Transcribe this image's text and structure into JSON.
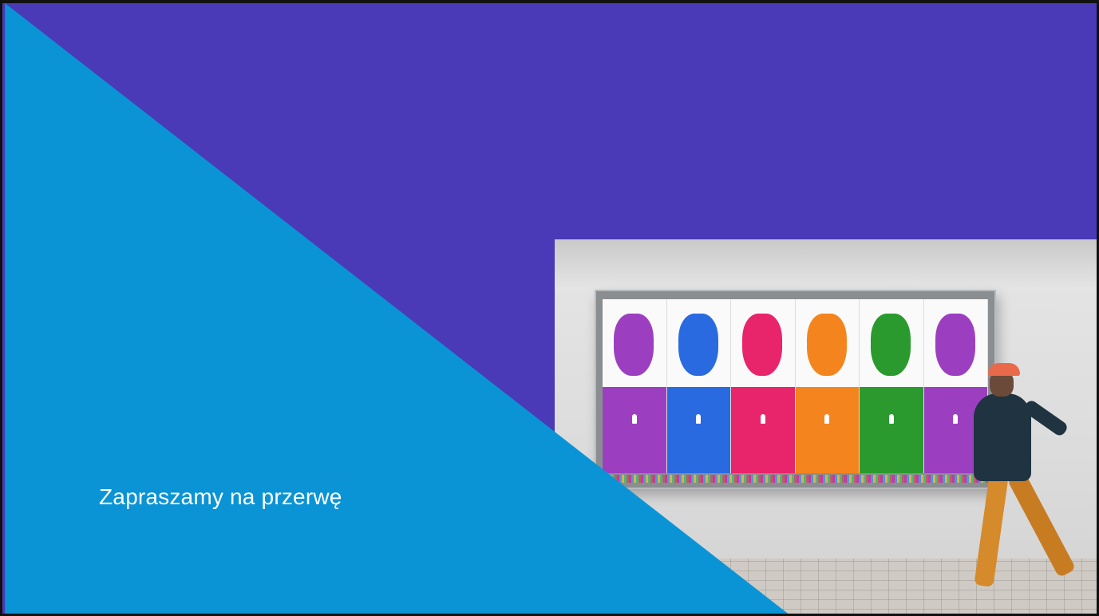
{
  "slide": {
    "caption": "Zapraszamy na przerwę",
    "colors": {
      "purple": "#4b3ab7",
      "blue": "#0a94d6"
    }
  },
  "photo": {
    "description_icon": "street-poster-photo",
    "poster_colors": [
      "#9b3fc0",
      "#2a6ae0",
      "#e8246b",
      "#f4851e",
      "#2a9a2e",
      "#9b3fc0"
    ]
  }
}
